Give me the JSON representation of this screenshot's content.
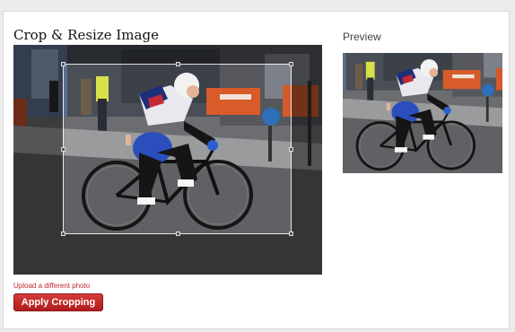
{
  "page": {
    "title": "Crop & Resize Image",
    "preview_label": "Preview"
  },
  "actions": {
    "upload_link": "Upload a different photo",
    "apply_button": "Apply Cropping"
  },
  "colors": {
    "accent": "#c0272d",
    "button_top": "#d53a3a",
    "button_bottom": "#b01c1c"
  },
  "icons": {
    "crop_handles": "square-handle"
  }
}
